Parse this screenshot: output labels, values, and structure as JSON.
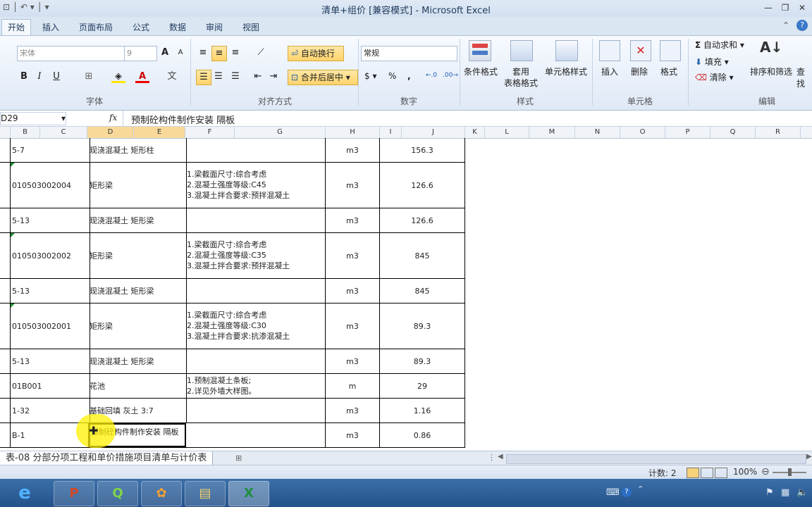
{
  "window": {
    "title": "清单+组价  [兼容模式]  -  Microsoft Excel",
    "min": "—",
    "max": "❐",
    "close": "✕"
  },
  "tabs": [
    "开始",
    "插入",
    "页面布局",
    "公式",
    "数据",
    "审阅",
    "视图"
  ],
  "ribbon": {
    "font_name": "宋体",
    "font_size": "9",
    "wrap_text": "自动换行",
    "merge_center": "合并后居中",
    "number_format": "常规",
    "cond_format": "条件格式",
    "format_table_1": "套用",
    "format_table_2": "表格格式",
    "cell_styles": "单元格样式",
    "insert": "插入",
    "delete": "删除",
    "format": "格式",
    "autosum": "自动求和",
    "fill": "填充",
    "clear": "清除",
    "sort_filter": "排序和筛选",
    "find": "查找",
    "groups": {
      "font": "字体",
      "align": "对齐方式",
      "number": "数字",
      "styles": "样式",
      "cells": "单元格",
      "edit": "编辑"
    }
  },
  "formula_bar": {
    "name_box": "D29",
    "fx": "fx",
    "formula": "预制砼构件制作安装 隔板"
  },
  "columns": [
    "B",
    "C",
    "D",
    "E",
    "F",
    "G",
    "H",
    "I",
    "J",
    "K",
    "L",
    "M",
    "N",
    "O",
    "P",
    "Q",
    "R"
  ],
  "rows": [
    {
      "code": "5-7",
      "name": "现浇混凝土 矩形柱",
      "desc": [],
      "unit": "m3",
      "qty": "156.3",
      "mark": false
    },
    {
      "code": "010503002004",
      "name": "矩形梁",
      "desc": [
        "1.梁截面尺寸:综合考虑",
        "2.混凝土强度等级:C45",
        "3.混凝土拌合要求:预拌混凝土"
      ],
      "unit": "m3",
      "qty": "126.6",
      "mark": true
    },
    {
      "code": "5-13",
      "name": "现浇混凝土 矩形梁",
      "desc": [],
      "unit": "m3",
      "qty": "126.6",
      "mark": false
    },
    {
      "code": "010503002002",
      "name": "矩形梁",
      "desc": [
        "1.梁截面尺寸:综合考虑",
        "2.混凝土强度等级:C35",
        "3.混凝土拌合要求:预拌混凝土"
      ],
      "unit": "m3",
      "qty": "845",
      "mark": true
    },
    {
      "code": "5-13",
      "name": "现浇混凝土 矩形梁",
      "desc": [],
      "unit": "m3",
      "qty": "845",
      "mark": false
    },
    {
      "code": "010503002001",
      "name": "矩形梁",
      "desc": [
        "1.梁截面尺寸:综合考虑",
        "2.混凝土强度等级:C30",
        "3.混凝土拌合要求:抗渗混凝土"
      ],
      "unit": "m3",
      "qty": "89.3",
      "mark": true
    },
    {
      "code": "5-13",
      "name": "现浇混凝土 矩形梁",
      "desc": [],
      "unit": "m3",
      "qty": "89.3",
      "mark": false
    },
    {
      "code": "01B001",
      "name": "花池",
      "desc": [
        "1.预制混凝土条板;",
        "2.详见外墙大样图。"
      ],
      "unit": "m",
      "qty": "29",
      "mark": false
    },
    {
      "code": "1-32",
      "name": "基础回填 灰土 3:7",
      "desc": [],
      "unit": "m3",
      "qty": "1.16",
      "mark": false
    },
    {
      "code": "B-1",
      "name": "预制砼构件制作安装 隔板",
      "desc": [],
      "unit": "m3",
      "qty": "0.86",
      "mark": false
    }
  ],
  "sheet_tab": "表-08 分部分项工程和单价措施项目清单与计价表",
  "status": {
    "count": "计数: 2",
    "zoom": "100%"
  },
  "taskbar_apps": [
    "IE",
    "PowerPoint",
    "Q4",
    "Planner",
    "Explorer",
    "Excel"
  ]
}
